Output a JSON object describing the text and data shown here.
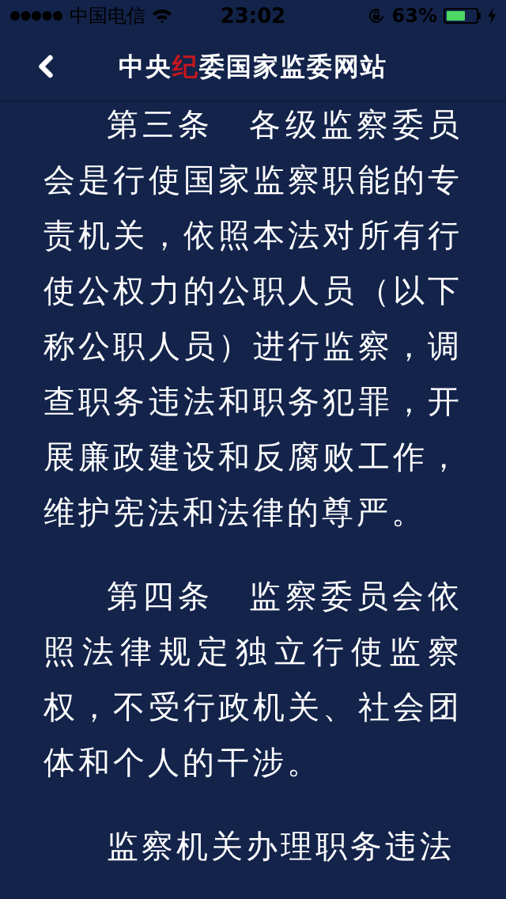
{
  "status_bar": {
    "carrier": "中国电信",
    "time": "23:02",
    "battery_percent": "63%",
    "battery": {
      "level": 0.63
    },
    "charging": true
  },
  "nav": {
    "title": [
      {
        "text": "中央",
        "color": "#ffffff"
      },
      {
        "text": "纪",
        "color": "#c8161d"
      },
      {
        "text": "委国家监委网站",
        "color": "#ffffff"
      }
    ]
  },
  "article": {
    "paragraphs": [
      "第三条　各级监察委员会是行使国家监察职能的专责机关，依照本法对所有行使公权力的公职人员（以下称公职人员）进行监察，调查职务违法和职务犯罪，开展廉政建设和反腐败工作，维护宪法和法律的尊严。",
      "第四条　监察委员会依照法律规定独立行使监察权，不受行政机关、社会团体和个人的干涉。",
      "监察机关办理职务违法"
    ]
  }
}
